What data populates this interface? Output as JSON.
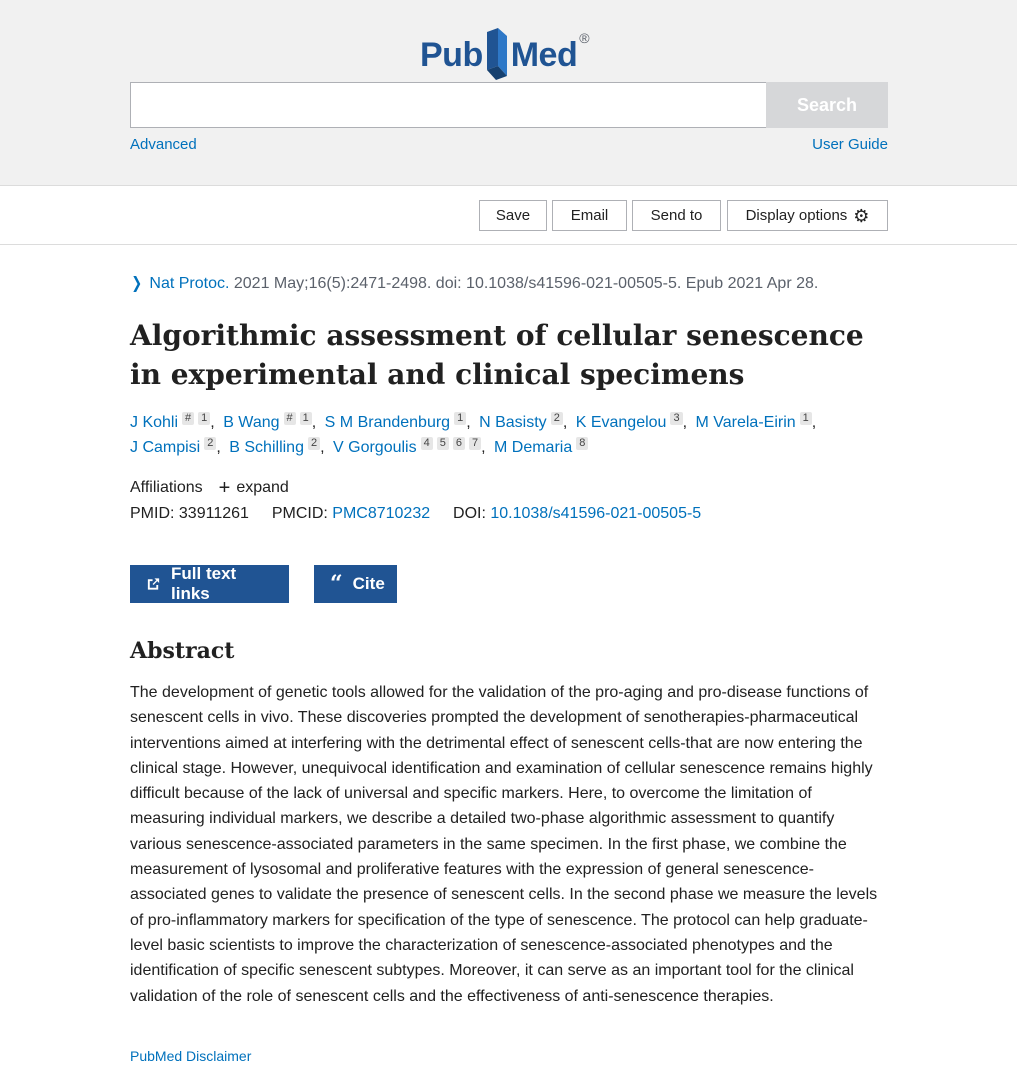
{
  "header": {
    "logo_part1": "Pub",
    "logo_part2": "Med",
    "logo_reg": "®",
    "search_placeholder": "",
    "search_value": "",
    "search_button": "Search",
    "advanced_link": "Advanced",
    "user_guide_link": "User Guide"
  },
  "toolbar": {
    "save": "Save",
    "email": "Email",
    "send_to": "Send to",
    "display_options": "Display options"
  },
  "citation": {
    "journal": "Nat Protoc.",
    "details": " 2021 May;16(5):2471-2498. doi: 10.1038/s41596-021-00505-5. Epub 2021 Apr 28."
  },
  "article": {
    "title": "Algorithmic assessment of cellular senescence in experimental and clinical specimens",
    "affiliations_label": "Affiliations",
    "expand_label": "expand",
    "pmid_label": "PMID:",
    "pmid_value": "33911261",
    "pmcid_label": "PMCID:",
    "pmcid_value": "PMC8710232",
    "doi_label": "DOI:",
    "doi_value": "10.1038/s41596-021-00505-5"
  },
  "authors": [
    {
      "name": "J Kohli",
      "marks": [
        "#",
        "1"
      ]
    },
    {
      "name": "B Wang",
      "marks": [
        "#",
        "1"
      ]
    },
    {
      "name": "S M Brandenburg",
      "marks": [
        "1"
      ]
    },
    {
      "name": "N Basisty",
      "marks": [
        "2"
      ]
    },
    {
      "name": "K Evangelou",
      "marks": [
        "3"
      ]
    },
    {
      "name": "M Varela-Eirin",
      "marks": [
        "1"
      ]
    },
    {
      "name": "J Campisi",
      "marks": [
        "2"
      ]
    },
    {
      "name": "B Schilling",
      "marks": [
        "2"
      ]
    },
    {
      "name": "V Gorgoulis",
      "marks": [
        "4",
        "5",
        "6",
        "7"
      ]
    },
    {
      "name": "M Demaria",
      "marks": [
        "8"
      ]
    }
  ],
  "actions": {
    "full_text": "Full text links",
    "cite": "Cite"
  },
  "abstract": {
    "heading": "Abstract",
    "text": "The development of genetic tools allowed for the validation of the pro-aging and pro-disease functions of senescent cells in vivo. These discoveries prompted the development of senotherapies-pharmaceutical interventions aimed at interfering with the detrimental effect of senescent cells-that are now entering the clinical stage. However, unequivocal identification and examination of cellular senescence remains highly difficult because of the lack of universal and specific markers. Here, to overcome the limitation of measuring individual markers, we describe a detailed two-phase algorithmic assessment to quantify various senescence-associated parameters in the same specimen. In the first phase, we combine the measurement of lysosomal and proliferative features with the expression of general senescence-associated genes to validate the presence of senescent cells. In the second phase we measure the levels of pro-inflammatory markers for specification of the type of senescence. The protocol can help graduate-level basic scientists to improve the characterization of senescence-associated phenotypes and the identification of specific senescent subtypes. Moreover, it can serve as an important tool for the clinical validation of the role of senescent cells and the effectiveness of anti-senescence therapies.",
    "disclaimer": "PubMed Disclaimer"
  }
}
